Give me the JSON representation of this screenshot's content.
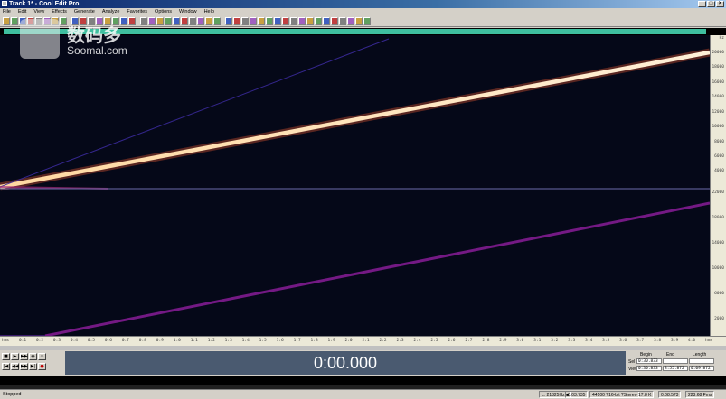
{
  "window": {
    "title": "Track 1* - Cool Edit Pro",
    "minimize": "_",
    "maximize": "□",
    "close": "×"
  },
  "menu": [
    "File",
    "Edit",
    "View",
    "Effects",
    "Generate",
    "Analyze",
    "Favorites",
    "Options",
    "Window",
    "Help"
  ],
  "toolbar": {
    "button_count": 44
  },
  "spectral": {
    "channel_divider": true,
    "lines": [
      {
        "color": "#ffe8c0",
        "role": "main sweep (top channel)"
      },
      {
        "color": "#3a2a9a",
        "role": "faint harmonic (top channel)"
      },
      {
        "color": "#8a1a9a",
        "role": "sweep (bottom channel)"
      }
    ]
  },
  "vruler_top": [
    "Hz",
    "20000",
    "18000",
    "16000",
    "14000",
    "12000",
    "10000",
    "8000",
    "6000",
    "4000",
    "2000"
  ],
  "vruler_bottom": [
    "22000",
    "18000",
    "14000",
    "10000",
    "6000",
    "2000"
  ],
  "hruler": [
    "hms",
    "0:1",
    "0:2",
    "0:3",
    "0:4",
    "0:5",
    "0:6",
    "0:7",
    "0:8",
    "0:9",
    "1:0",
    "1:1",
    "1:2",
    "1:3",
    "1:4",
    "1:5",
    "1:6",
    "1:7",
    "1:8",
    "1:9",
    "2:0",
    "2:1",
    "2:2",
    "2:3",
    "2:4",
    "2:5",
    "2:6",
    "2:7",
    "2:8",
    "2:9",
    "3:0",
    "3:1",
    "3:2",
    "3:3",
    "3:4",
    "3:5",
    "3:6",
    "3:7",
    "3:8",
    "3:9",
    "4:0",
    "hms"
  ],
  "transport": {
    "buttons": [
      "■",
      "▶",
      "▶▶",
      "◉",
      "∞",
      "|◀",
      "◀◀",
      "▶▶",
      "▶|",
      "●"
    ]
  },
  "time": "0:00.000",
  "selection": {
    "headers": [
      "Begin",
      "End",
      "Length"
    ],
    "rows": [
      {
        "label": "Sel",
        "values": [
          "0:30.833",
          "",
          ""
        ]
      },
      {
        "label": "View",
        "values": [
          "0:30.833",
          "8:55.872",
          "0:09.872"
        ]
      }
    ]
  },
  "status": {
    "left": "Stopped",
    "cells": [
      "L: 21325Hz  ■",
      "0:03.735",
      "44100 ?16-bit ?Stereo",
      "17.8 K",
      "0:08.573",
      "223.68 Fms"
    ]
  },
  "watermark": {
    "cn": "数码多",
    "en": "Soomal.com"
  },
  "colors": {
    "overview": "#3fbf9f",
    "display": "#4a5a70",
    "spectral_bg": "#050818"
  }
}
